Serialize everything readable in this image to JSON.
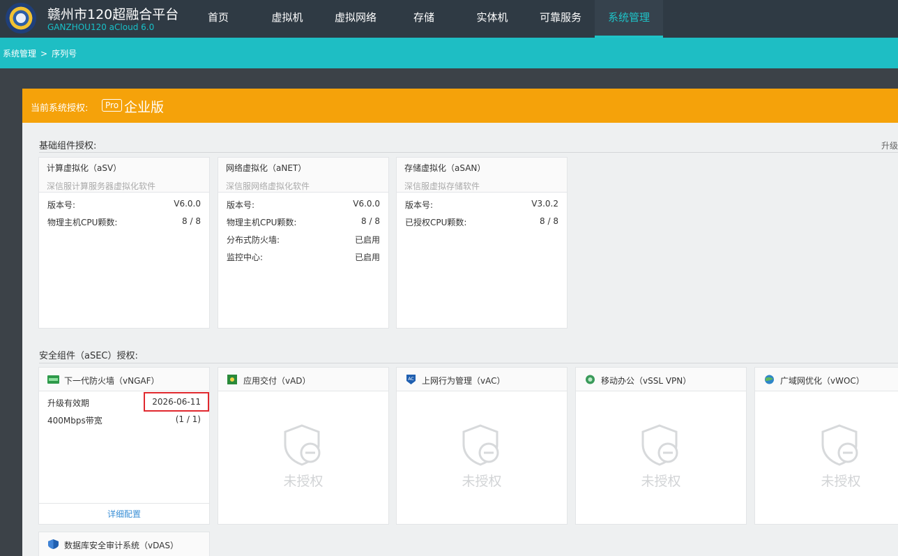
{
  "header": {
    "title": "赣州市120超融合平台",
    "subtitle": "GANZHOU120 aCloud 6.0",
    "nav": [
      "首页",
      "虚拟机",
      "虚拟网络",
      "存储",
      "实体机",
      "可靠服务",
      "系统管理"
    ]
  },
  "breadcrumb": {
    "root": "系统管理",
    "sep": ">",
    "current": "序列号"
  },
  "license": {
    "label": "当前系统授权:",
    "badge": "Pro",
    "edition": "企业版"
  },
  "basic": {
    "title": "基础组件授权:",
    "upgrade": "升级",
    "cards": [
      {
        "name": "计算虚拟化（aSV）",
        "desc": "深信服计算服务器虚拟化软件",
        "rows": [
          {
            "k": "版本号:",
            "v": "V6.0.0"
          },
          {
            "k": "物理主机CPU颗数:",
            "v": "8 / 8"
          }
        ]
      },
      {
        "name": "网络虚拟化（aNET）",
        "desc": "深信服网络虚拟化软件",
        "rows": [
          {
            "k": "版本号:",
            "v": "V6.0.0"
          },
          {
            "k": "物理主机CPU颗数:",
            "v": "8 / 8"
          },
          {
            "k": "分布式防火墙:",
            "v": "已启用"
          },
          {
            "k": "监控中心:",
            "v": "已启用"
          }
        ]
      },
      {
        "name": "存储虚拟化（aSAN）",
        "desc": "深信服虚拟存储软件",
        "rows": [
          {
            "k": "版本号:",
            "v": "V3.0.2"
          },
          {
            "k": "已授权CPU颗数:",
            "v": "8 / 8"
          }
        ]
      }
    ]
  },
  "security": {
    "title": "安全组件（aSEC）授权:",
    "cards": [
      {
        "name": "下一代防火墙（vNGAF）",
        "icon": "ngaf-icon",
        "icon_color": "#2e9a4a",
        "rows": [
          {
            "k": "升级有效期",
            "v": "2026-06-11"
          },
          {
            "k": "400Mbps带宽",
            "v": "(1 / 1)"
          }
        ],
        "detail": "详细配置"
      },
      {
        "name": "应用交付（vAD）",
        "icon": "ad-icon",
        "icon_color": "#2a8a3a",
        "unlicensed": "未授权"
      },
      {
        "name": "上网行为管理（vAC）",
        "icon": "ac-icon",
        "icon_color": "#1f5fb0",
        "unlicensed": "未授权"
      },
      {
        "name": "移动办公（vSSL VPN）",
        "icon": "vpn-icon",
        "icon_color": "#3a9a5a",
        "unlicensed": "未授权"
      },
      {
        "name": "广域网优化（vWOC）",
        "icon": "woc-icon",
        "icon_color": "#2f86c8",
        "unlicensed": "未授权"
      },
      {
        "name": "数据库安全审计系统（vDAS）",
        "icon": "das-icon",
        "icon_color": "#1f5fb0"
      }
    ]
  },
  "colors": {
    "accent": "#1ebec4",
    "license_bar": "#f5a20a",
    "highlight": "#e0282e",
    "topbar": "#2f3a44"
  }
}
